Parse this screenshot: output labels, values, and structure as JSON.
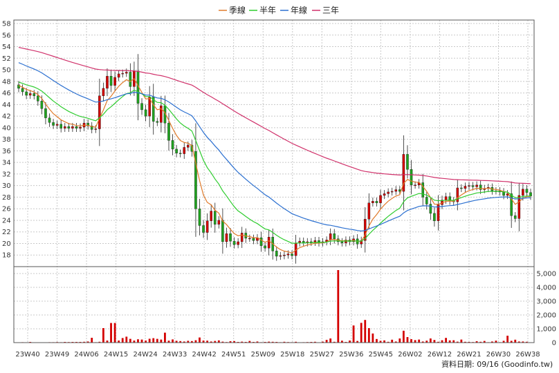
{
  "chart_data": {
    "type": "candlestick",
    "legend": [
      {
        "label": "季線",
        "color": "#e07a2a"
      },
      {
        "label": "半年",
        "color": "#2ecc2e"
      },
      {
        "label": "年線",
        "color": "#2a6fd0"
      },
      {
        "label": "三年",
        "color": "#d0306a"
      }
    ],
    "x_ticks": [
      "23W40",
      "23W49",
      "24W06",
      "24W15",
      "24W24",
      "24W33",
      "24W42",
      "24W51",
      "25W09",
      "25W18",
      "25W27",
      "25W36",
      "25W45",
      "26W02",
      "26W12",
      "26W21",
      "26W30",
      "26W38"
    ],
    "price_axis": {
      "ticks": [
        18,
        20,
        22,
        24,
        26,
        28,
        30,
        32,
        34,
        36,
        38,
        40,
        42,
        44,
        46,
        48,
        50,
        52,
        54,
        56,
        58
      ],
      "ylim": [
        16,
        58.6
      ]
    },
    "volume_axis": {
      "ticks": [
        "5,000",
        "4,000",
        "3,000",
        "2,000",
        "1,000",
        "0"
      ],
      "ylim": [
        0,
        5500
      ]
    },
    "source_text": "資料日期: 09/16 (Goodinfo.tw)",
    "colors": {
      "up": "#d40000",
      "down": "#1fa31f",
      "volume": "#d40000"
    },
    "close": [
      46.8,
      46.2,
      45.6,
      45.9,
      45.5,
      44.6,
      43.3,
      41.7,
      40.9,
      40.4,
      40.6,
      39.9,
      40.2,
      39.9,
      40.2,
      39.9,
      40.1,
      40.8,
      40.3,
      39.7,
      39.8,
      45.5,
      46.8,
      48.9,
      47.3,
      48.7,
      49.3,
      49.4,
      49.6,
      47.1,
      49.8,
      44.2,
      43.1,
      42.0,
      45.3,
      41.1,
      40.9,
      43.8,
      40.8,
      37.8,
      36.3,
      35.6,
      35.5,
      36.6,
      37.0,
      35.9,
      26.0,
      23.1,
      21.9,
      23.9,
      25.6,
      23.3,
      24.0,
      20.3,
      21.7,
      20.4,
      19.8,
      20.3,
      21.8,
      20.9,
      20.9,
      20.5,
      21.0,
      19.6,
      19.2,
      21.1,
      18.7,
      17.8,
      17.9,
      18.0,
      18.2,
      17.9,
      20.1,
      20.4,
      20.1,
      20.3,
      20.2,
      20.5,
      20.1,
      20.3,
      20.6,
      21.7,
      20.8,
      20.3,
      20.1,
      20.6,
      20.3,
      20.8,
      19.9,
      20.5,
      24.2,
      27.0,
      27.3,
      27.0,
      28.3,
      28.6,
      28.9,
      29.0,
      29.3,
      29.0,
      35.4,
      32.8,
      30.1,
      30.1,
      30.5,
      28.0,
      26.8,
      25.2,
      23.9,
      26.7,
      27.5,
      28.1,
      27.4,
      27.2,
      29.6,
      29.5,
      29.9,
      30.0,
      29.8,
      30.1,
      29.3,
      29.5,
      29.7,
      29.1,
      29.1,
      28.9,
      28.3,
      28.6,
      24.8,
      24.3,
      28.3,
      29.4,
      28.8,
      28.2
    ],
    "volume": [
      20,
      30,
      10,
      50,
      20,
      10,
      20,
      20,
      30,
      30,
      40,
      30,
      50,
      40,
      50,
      50,
      50,
      60,
      80,
      350,
      30,
      60,
      1050,
      150,
      1420,
      1420,
      150,
      330,
      430,
      270,
      150,
      240,
      220,
      150,
      280,
      320,
      270,
      220,
      720,
      140,
      230,
      130,
      110,
      80,
      130,
      110,
      170,
      370,
      150,
      140,
      80,
      120,
      160,
      70,
      40,
      100,
      110,
      50,
      70,
      50,
      120,
      50,
      80,
      30,
      50,
      70,
      60,
      50,
      30,
      60,
      40,
      30,
      60,
      20,
      30,
      40,
      50,
      60,
      20,
      70,
      200,
      300,
      60,
      5250,
      140,
      50,
      150,
      1240,
      120,
      1430,
      1640,
      1050,
      660,
      260,
      130,
      160,
      60,
      210,
      80,
      300,
      860,
      400,
      250,
      180,
      220,
      80,
      140,
      300,
      190,
      60,
      170,
      340,
      160,
      170,
      70,
      220,
      60,
      50,
      40,
      100,
      60,
      120,
      30,
      80,
      140,
      30,
      130,
      500,
      130,
      210,
      80,
      80,
      60
    ]
  }
}
